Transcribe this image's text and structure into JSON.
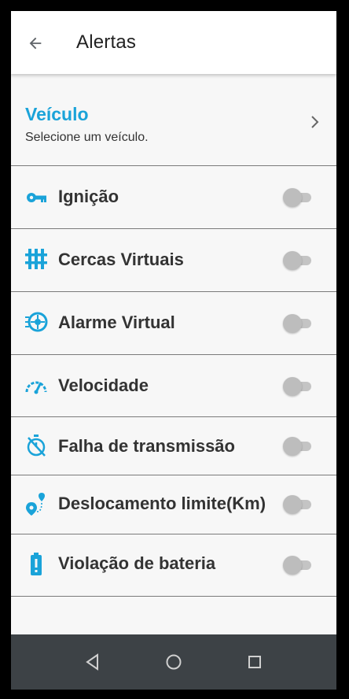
{
  "appbar": {
    "title": "Alertas",
    "back_icon": "arrow-left-icon"
  },
  "vehicle": {
    "title": "Veículo",
    "subtitle": "Selecione um veículo.",
    "icon": "chevron-right-icon"
  },
  "colors": {
    "accent": "#1aa3d9",
    "text": "#333333",
    "divider": "#7a7a7a",
    "background": "#f7f7f7",
    "navbar": "#3d4246",
    "toggle_off": "#bdbdbd"
  },
  "alerts": [
    {
      "label": "Ignição",
      "icon": "key-icon",
      "enabled": false
    },
    {
      "label": "Cercas Virtuais",
      "icon": "fence-icon",
      "enabled": false
    },
    {
      "label": "Alarme Virtual",
      "icon": "alarm-wheel-icon",
      "enabled": false
    },
    {
      "label": "Velocidade",
      "icon": "speedometer-icon",
      "enabled": false
    },
    {
      "label": "Falha de transmissão",
      "icon": "timer-off-icon",
      "enabled": false
    },
    {
      "label": "Deslocamento limite(Km)",
      "icon": "route-icon",
      "enabled": false
    },
    {
      "label": "Violação de bateria",
      "icon": "battery-alert-icon",
      "enabled": false
    }
  ],
  "navbar": {
    "back_icon": "nav-back-icon",
    "home_icon": "nav-home-icon",
    "recents_icon": "nav-recents-icon"
  }
}
